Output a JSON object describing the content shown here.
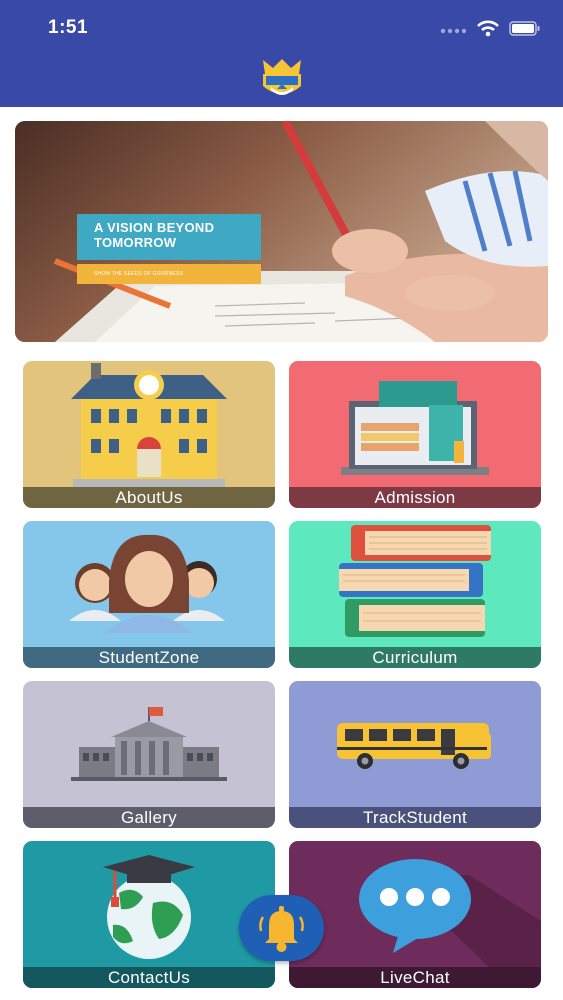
{
  "status_bar": {
    "time": "1:51"
  },
  "banner": {
    "headline": "A VISION BEYOND TOMORROW",
    "tagline": "SHOW THE SEEDS OF GOODNESS"
  },
  "tiles": [
    {
      "label": "AboutUs",
      "bg": "#e3c47d",
      "band": "#6f6542",
      "icon": "school-building-icon"
    },
    {
      "label": "Admission",
      "bg": "#f26b72",
      "band": "#7d3a44",
      "icon": "laptop-books-icon"
    },
    {
      "label": "StudentZone",
      "bg": "#84c7ea",
      "band": "#3f6a82",
      "icon": "students-icon"
    },
    {
      "label": "Curriculum",
      "bg": "#5ee8bd",
      "band": "#2e7a64",
      "icon": "books-stack-icon"
    },
    {
      "label": "Gallery",
      "bg": "#c5c3d3",
      "band": "#5d5d6c",
      "icon": "government-building-icon"
    },
    {
      "label": "TrackStudent",
      "bg": "#8f9bd4",
      "band": "#4a527c",
      "icon": "school-bus-icon"
    },
    {
      "label": "ContactUs",
      "bg": "#1f9aa4",
      "band": "#13585f",
      "icon": "graduation-globe-icon"
    },
    {
      "label": "LiveChat",
      "bg": "#6e2c5c",
      "band": "#3e1934",
      "icon": "chat-bubble-icon"
    }
  ],
  "colors": {
    "appbar": "#3949a8",
    "fab": "#1f5fb5"
  },
  "fab": {
    "icon": "bell-icon"
  }
}
